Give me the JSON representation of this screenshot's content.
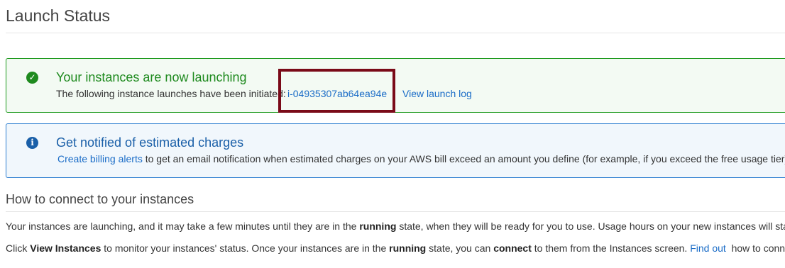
{
  "page": {
    "title": "Launch Status"
  },
  "success_alert": {
    "icon": "check-circle-icon",
    "color": "#1e8a1e",
    "heading": "Your instances are now launching",
    "body_text": "The following instance launches have been initiated:",
    "instance_id": "i-04935307ab64ea94e",
    "launch_log_link": "View launch log"
  },
  "info_alert": {
    "icon": "info-circle-icon",
    "color": "#1a5fa8",
    "heading": "Get notified of estimated charges",
    "billing_link": "Create billing alerts",
    "body_text": " to get an email notification when estimated charges on your AWS bill exceed an amount you define (for example, if you exceed the free usage tier)."
  },
  "connect_section": {
    "heading": "How to connect to your instances",
    "para1": {
      "before": "Your instances are launching, and it may take a few minutes until they are in the ",
      "bold": "running",
      "after": " state, when they will be ready for you to use. Usage hours on your new instances will start"
    },
    "para2": {
      "part1": "Click ",
      "bold1": "View Instances",
      "part2": " to monitor your instances' status. Once your instances are in the ",
      "bold2": "running",
      "part3": " state, you can ",
      "bold3": "connect",
      "part4": " to them from the Instances screen. ",
      "link": "Find out",
      "part5": "  how to connect"
    }
  },
  "annotation": {
    "highlight_color": "#7a0a18"
  }
}
